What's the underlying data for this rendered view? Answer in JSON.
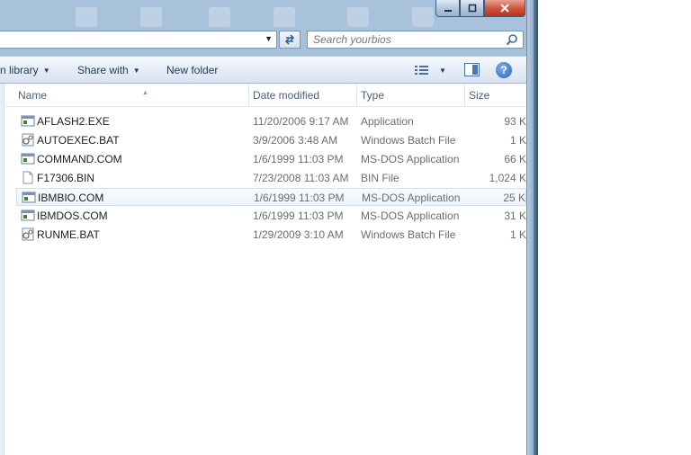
{
  "window": {
    "caption_buttons": {
      "minimize": "minimize-icon",
      "maximize": "maximize-icon",
      "close": "close-icon"
    }
  },
  "address_bar": {
    "dropdown_icon": "chevron-down-icon",
    "refresh_icon": "refresh-icon"
  },
  "search": {
    "placeholder": "Search yourbios",
    "icon": "search-icon"
  },
  "toolbar": {
    "include_in_library": "n library",
    "share_with": "Share with",
    "new_folder": "New folder",
    "view_icon": "details-view-icon",
    "preview_pane_icon": "preview-pane-icon",
    "help_label": "?"
  },
  "columns": {
    "name": "Name",
    "date_modified": "Date modified",
    "type": "Type",
    "size": "Size"
  },
  "files": [
    {
      "name": "AFLASH2.EXE",
      "date": "11/20/2006 9:17 AM",
      "type": "Application",
      "size": "93 K",
      "icon": "application-icon"
    },
    {
      "name": "AUTOEXEC.BAT",
      "date": "3/9/2006 3:48 AM",
      "type": "Windows Batch File",
      "size": "1 K",
      "icon": "batch-file-icon"
    },
    {
      "name": "COMMAND.COM",
      "date": "1/6/1999 11:03 PM",
      "type": "MS-DOS Application",
      "size": "66 K",
      "icon": "application-icon"
    },
    {
      "name": "F17306.BIN",
      "date": "7/23/2008 11:03 AM",
      "type": "BIN File",
      "size": "1,024 K",
      "icon": "file-icon"
    },
    {
      "name": "IBMBIO.COM",
      "date": "1/6/1999 11:03 PM",
      "type": "MS-DOS Application",
      "size": "25 K",
      "icon": "application-icon"
    },
    {
      "name": "IBMDOS.COM",
      "date": "1/6/1999 11:03 PM",
      "type": "MS-DOS Application",
      "size": "31 K",
      "icon": "application-icon"
    },
    {
      "name": "RUNME.BAT",
      "date": "1/29/2009 3:10 AM",
      "type": "Windows Batch File",
      "size": "1 K",
      "icon": "batch-file-icon"
    }
  ],
  "selected_index": 4
}
